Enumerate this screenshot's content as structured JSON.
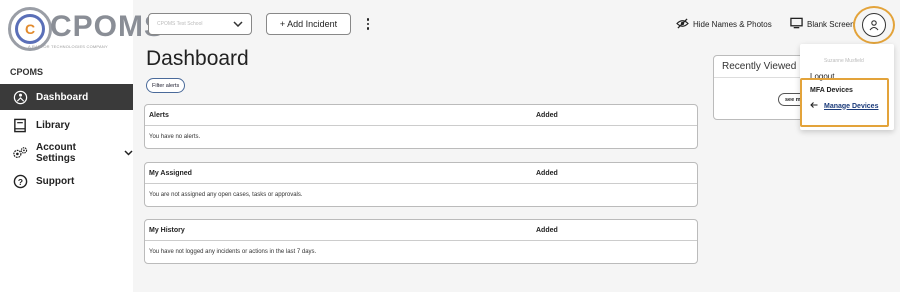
{
  "app": {
    "logo_text": "CPOMS",
    "logo_sub": "A RAPTOR TECHNOLOGIES COMPANY",
    "section_label": "CPOMS"
  },
  "sidebar": {
    "items": [
      {
        "label": "Dashboard",
        "icon": "dashboard-icon",
        "active": true
      },
      {
        "label": "Library",
        "icon": "book-icon",
        "active": false
      },
      {
        "label": "Account Settings",
        "icon": "gears-icon",
        "active": false,
        "has_chevron": true
      },
      {
        "label": "Support",
        "icon": "help-icon",
        "active": false
      }
    ]
  },
  "topbar": {
    "school_select_value": "CPOMS Test School",
    "add_incident_label": "+ Add Incident",
    "hide_names_label": "Hide Names & Photos",
    "blank_screen_label": "Blank Screen"
  },
  "main": {
    "title": "Dashboard",
    "filter_label": "Filter alerts",
    "panels": [
      {
        "heading": "Alerts",
        "added": "Added",
        "empty_text": "You have no alerts."
      },
      {
        "heading": "My Assigned",
        "added": "Added",
        "empty_text": "You are not assigned any open cases, tasks or approvals."
      },
      {
        "heading": "My History",
        "added": "Added",
        "empty_text": "You have not logged any incidents or actions in the last 7 days."
      }
    ]
  },
  "recently_viewed": {
    "title": "Recently Viewed",
    "see_more": "see m"
  },
  "user_menu": {
    "user_name": "Suzanne Musfield",
    "logout": "Logout",
    "mfa_devices": "MFA Devices",
    "manage_devices": "Manage Devices"
  },
  "colors": {
    "highlight": "#e3a33a",
    "active_nav": "#3a3a3a",
    "link": "#1a3a7a"
  }
}
